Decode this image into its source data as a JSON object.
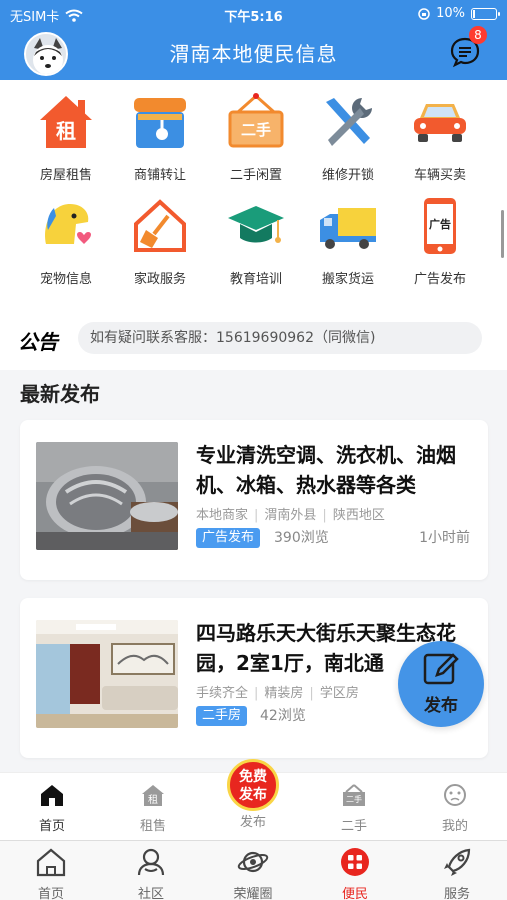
{
  "status_bar": {
    "carrier": "无SIM卡",
    "time": "下午5:16",
    "battery": "10%",
    "battery_level": 0.1
  },
  "header": {
    "title": "渭南本地便民信息",
    "badge_count": "8"
  },
  "categories": [
    {
      "label": "房屋租售",
      "icon": "rent-house-icon",
      "icon_text": "租"
    },
    {
      "label": "商铺转让",
      "icon": "shop-icon"
    },
    {
      "label": "二手闲置",
      "icon": "secondhand-sign-icon",
      "icon_text": "二手"
    },
    {
      "label": "维修开锁",
      "icon": "tools-icon"
    },
    {
      "label": "车辆买卖",
      "icon": "car-icon"
    },
    {
      "label": "宠物信息",
      "icon": "pet-icon"
    },
    {
      "label": "家政服务",
      "icon": "broom-house-icon"
    },
    {
      "label": "教育培训",
      "icon": "graduation-cap-icon"
    },
    {
      "label": "搬家货运",
      "icon": "truck-icon"
    },
    {
      "label": "广告发布",
      "icon": "phone-ad-icon",
      "icon_text": "广告"
    }
  ],
  "notice": {
    "tag": "公告",
    "text": "如有疑问联系客服：15619690962（同微信)"
  },
  "latest": {
    "title": "最新发布"
  },
  "posts": [
    {
      "title": "专业清洗空调、洗衣机、油烟机、冰箱、热水器等各类",
      "meta": [
        "本地商家",
        "渭南外县",
        "陕西地区"
      ],
      "tag": "广告发布",
      "views": "390浏览",
      "time": "1小时前"
    },
    {
      "title": "四马路乐天大街乐天聚生态花园，2室1厅，南北通",
      "meta": [
        "手续齐全",
        "精装房",
        "学区房"
      ],
      "tag": "二手房",
      "views": "42浏览",
      "time": ""
    }
  ],
  "fab": {
    "label": "发布"
  },
  "inner_tabs": [
    {
      "label": "首页",
      "icon": "home-icon"
    },
    {
      "label": "租售",
      "icon": "rent-house-icon"
    },
    {
      "label": "发布",
      "icon": "free-publish-icon",
      "promo": "免费发布"
    },
    {
      "label": "二手",
      "icon": "secondhand-sign-icon"
    },
    {
      "label": "我的",
      "icon": "face-icon"
    }
  ],
  "main_tabs": [
    {
      "label": "首页",
      "icon": "home-outline-icon"
    },
    {
      "label": "社区",
      "icon": "community-icon"
    },
    {
      "label": "荣耀圈",
      "icon": "planet-icon"
    },
    {
      "label": "便民",
      "icon": "grid-icon"
    },
    {
      "label": "服务",
      "icon": "rocket-icon"
    }
  ],
  "colors": {
    "primary": "#3b8fe6",
    "accent": "#e8261f",
    "tag_blue": "#4a9bf0"
  }
}
